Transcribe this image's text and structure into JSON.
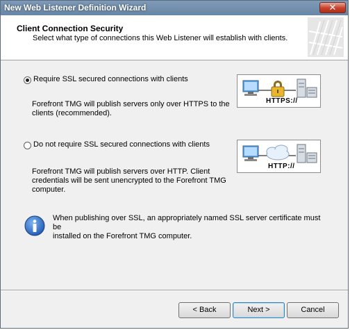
{
  "window": {
    "title": "New Web Listener Definition Wizard",
    "close_glyph": "✕"
  },
  "header": {
    "title": "Client Connection Security",
    "subtitle": "Select what type of connections this Web Listener will establish with clients."
  },
  "options": [
    {
      "label": "Require SSL secured connections with clients",
      "selected": true,
      "desc_lines": [
        "Forefront TMG will publish servers only over HTTPS to the",
        "clients (recommended)."
      ],
      "diagram_label": "HTTPS://",
      "diagram_icon": "ssl-lock-icon"
    },
    {
      "label": "Do not require SSL secured connections with clients",
      "selected": false,
      "desc_lines": [
        "Forefront TMG will publish servers over HTTP. Client",
        "credentials will be sent unencrypted to the Forefront TMG",
        "computer."
      ],
      "diagram_label": "HTTP://",
      "diagram_icon": "cloud-icon"
    }
  ],
  "info": {
    "lines": [
      "When publishing over SSL, an appropriately named SSL server certificate must be",
      "installed on the Forefront TMG computer."
    ],
    "icon": "info-icon"
  },
  "buttons": {
    "back": "< Back",
    "next": "Next >",
    "cancel": "Cancel"
  }
}
